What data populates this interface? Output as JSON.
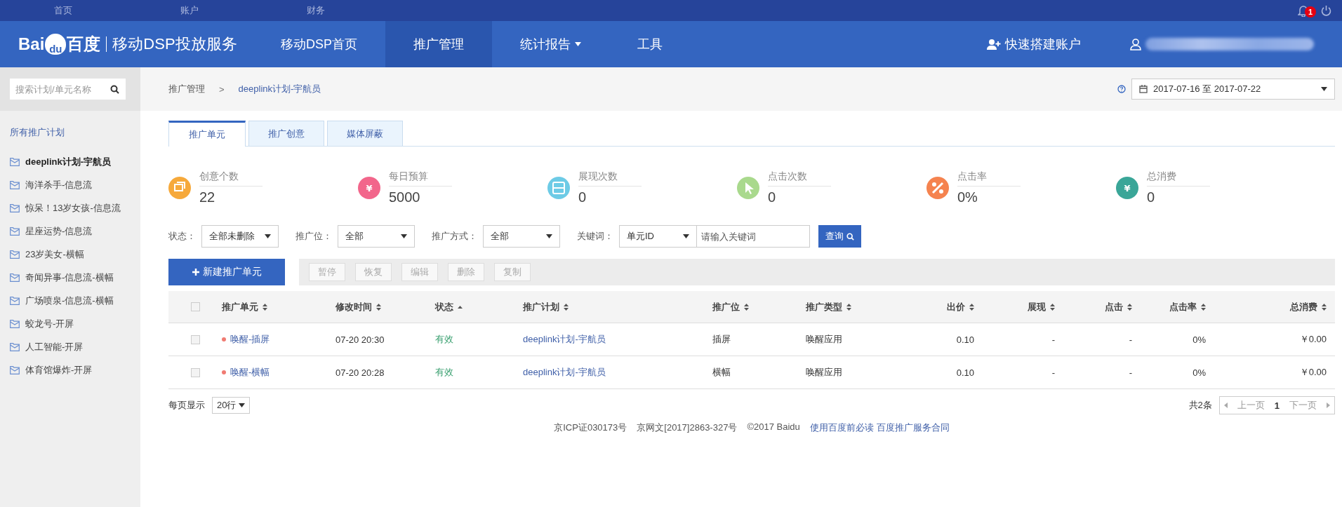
{
  "topbar": {
    "links": [
      "首页",
      "账户",
      "财务"
    ],
    "notification_count": "1"
  },
  "header": {
    "logo": {
      "left": "Bai",
      "paw": "du",
      "right": "百度"
    },
    "brand": "移动DSP投放服务",
    "nav": [
      {
        "label": "移动DSP首页",
        "selected": false,
        "dropdown": false
      },
      {
        "label": "推广管理",
        "selected": true,
        "dropdown": false
      },
      {
        "label": "统计报告",
        "selected": false,
        "dropdown": true
      },
      {
        "label": "工具",
        "selected": false,
        "dropdown": false
      }
    ],
    "quick_setup": "快速搭建账户"
  },
  "sidebar": {
    "search_placeholder": "搜索计划/单元名称",
    "all_plans": "所有推广计划",
    "plans": [
      {
        "label": "deeplink计划-宇航员",
        "selected": true
      },
      {
        "label": "海洋杀手-信息流",
        "selected": false
      },
      {
        "label": "惊呆！13岁女孩-信息流",
        "selected": false
      },
      {
        "label": "星座运势-信息流",
        "selected": false
      },
      {
        "label": "23岁美女-横幅",
        "selected": false
      },
      {
        "label": "奇闻异事-信息流-横幅",
        "selected": false
      },
      {
        "label": "广场喷泉-信息流-横幅",
        "selected": false
      },
      {
        "label": "蛟龙号-开屏",
        "selected": false
      },
      {
        "label": "人工智能-开屏",
        "selected": false
      },
      {
        "label": "体育馆爆炸-开屏",
        "selected": false
      }
    ]
  },
  "breadcrumb": {
    "items": [
      "推广管理",
      "deeplink计划-宇航员"
    ],
    "separator": ">"
  },
  "date_range": "2017-07-16 至 2017-07-22",
  "tabs": [
    {
      "label": "推广单元",
      "selected": true
    },
    {
      "label": "推广创意",
      "selected": false
    },
    {
      "label": "媒体屏蔽",
      "selected": false
    }
  ],
  "stats": [
    {
      "kind": "creative",
      "label": "创意个数",
      "value": "22",
      "color": "#f6a93b"
    },
    {
      "kind": "yen",
      "symbol": "¥",
      "label": "每日预算",
      "value": "5000",
      "color": "#f2668b"
    },
    {
      "kind": "display",
      "label": "展现次数",
      "value": "0",
      "color": "#6dcbe6"
    },
    {
      "kind": "cursor",
      "label": "点击次数",
      "value": "0",
      "color": "#a9d98d"
    },
    {
      "kind": "percent",
      "label": "点击率",
      "value": "0%",
      "color": "#f5834f"
    },
    {
      "kind": "yen",
      "symbol": "¥",
      "label": "总消费",
      "value": "0",
      "color": "#3aa698"
    }
  ],
  "filters": [
    {
      "label": "状态：",
      "value": "全部未删除"
    },
    {
      "label": "推广位：",
      "value": "全部"
    },
    {
      "label": "推广方式：",
      "value": "全部"
    }
  ],
  "keyword": {
    "label": "关键词：",
    "type": "单元ID",
    "placeholder": "请输入关键词",
    "button": "查询"
  },
  "new_button": "新建推广单元",
  "actions": [
    {
      "label": "暂停",
      "disabled": true
    },
    {
      "label": "恢复",
      "disabled": true
    },
    {
      "label": "编辑",
      "disabled": true
    },
    {
      "label": "删除",
      "disabled": true
    },
    {
      "label": "复制",
      "disabled": true
    }
  ],
  "table": {
    "select_all_checked": false,
    "columns": [
      {
        "label": "推广单元",
        "sorted": false
      },
      {
        "label": "修改时间",
        "sorted": false
      },
      {
        "label": "状态",
        "sorted": true
      },
      {
        "label": "推广计划",
        "sorted": false
      },
      {
        "label": "推广位",
        "sorted": false
      },
      {
        "label": "推广类型",
        "sorted": false
      },
      {
        "label": "出价",
        "sorted": false
      },
      {
        "label": "展现",
        "sorted": false
      },
      {
        "label": "点击",
        "sorted": false
      },
      {
        "label": "点击率",
        "sorted": false
      },
      {
        "label": "总消费",
        "sorted": false
      }
    ],
    "rows": [
      {
        "checked": false,
        "color": "#f07b72",
        "cells": [
          "唤醒-插屏",
          "07-20 20:30",
          "有效",
          "deeplink计划-宇航员",
          "插屏",
          "唤醒应用",
          "0.10",
          "-",
          "-",
          "0%",
          "￥0.00"
        ]
      },
      {
        "checked": false,
        "color": "#f07b72",
        "cells": [
          "唤醒-横幅",
          "07-20 20:28",
          "有效",
          "deeplink计划-宇航员",
          "横幅",
          "唤醒应用",
          "0.10",
          "-",
          "-",
          "0%",
          "￥0.00"
        ]
      }
    ]
  },
  "pagination": {
    "per_page_label": "每页显示",
    "per_page": "20行",
    "total": "共2条",
    "prev": "上一页",
    "page": "1",
    "next": "下一页"
  },
  "footer": {
    "texts": [
      "京ICP证030173号",
      "京网文[2017]2863-327号",
      "©2017 Baidu"
    ],
    "links": [
      "使用百度前必读",
      "百度推广服务合同"
    ]
  }
}
